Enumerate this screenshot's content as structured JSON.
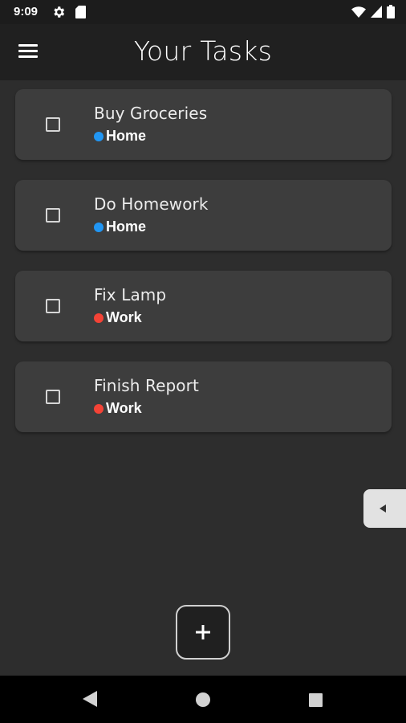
{
  "status_bar": {
    "time": "9:09",
    "icons": [
      "gear-icon",
      "sd-card-icon",
      "wifi-icon",
      "signal-icon",
      "battery-icon"
    ]
  },
  "app_bar": {
    "title": "Your Tasks",
    "menu_icon": "hamburger-menu-icon"
  },
  "tasks": [
    {
      "title": "Buy Groceries",
      "category": "Home",
      "category_color": "#2196f3",
      "checked": false
    },
    {
      "title": "Do Homework",
      "category": "Home",
      "category_color": "#2196f3",
      "checked": false
    },
    {
      "title": "Fix Lamp",
      "category": "Work",
      "category_color": "#f44336",
      "checked": false
    },
    {
      "title": "Finish Report",
      "category": "Work",
      "category_color": "#f44336",
      "checked": false
    }
  ],
  "side_tab": {
    "icon": "chevron-left-icon"
  },
  "fab": {
    "icon": "plus-icon"
  },
  "nav_bar": {
    "icons": [
      "back-icon",
      "home-icon",
      "recents-icon"
    ]
  },
  "colors": {
    "background": "#2d2d2d",
    "app_bar": "#202020",
    "card": "#3d3d3d",
    "home_category": "#2196f3",
    "work_category": "#f44336"
  }
}
